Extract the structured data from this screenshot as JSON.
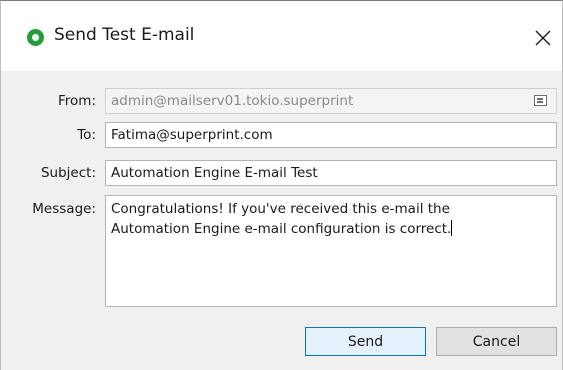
{
  "window": {
    "title": "Send Test E-mail",
    "title_icon": "green-status-circle-icon",
    "close_icon": "close-icon"
  },
  "form": {
    "from_label": "From:",
    "from_value": "admin@mailserv01.tokio.superprint",
    "from_icon": "address-book-icon",
    "to_label": "To:",
    "to_value": "Fatima@superprint.com",
    "subject_label": "Subject:",
    "subject_value": "Automation Engine E-mail Test",
    "message_label": "Message:",
    "message_line1": "Congratulations! If you've received this e-mail the",
    "message_line2": "Automation Engine e-mail configuration is correct."
  },
  "buttons": {
    "send_label": "Send",
    "cancel_label": "Cancel"
  },
  "colors": {
    "title_icon": "#1f9e3a",
    "default_button_border": "#0078d7",
    "default_button_bg": "#e5f1fb"
  }
}
